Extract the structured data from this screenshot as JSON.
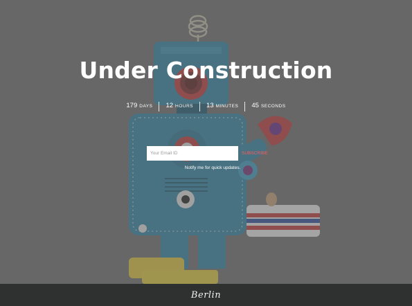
{
  "page": {
    "title": "Under Construction"
  },
  "countdown": [
    {
      "value": "179",
      "unit": "days"
    },
    {
      "value": "12",
      "unit": "hours"
    },
    {
      "value": "13",
      "unit": "minutes"
    },
    {
      "value": "45",
      "unit": "seconds"
    }
  ],
  "subscribe": {
    "placeholder": "Your Email ID",
    "button_label": "SUBSCRIBE",
    "note": "Notify me for quick updates."
  },
  "footer": {
    "brand": "Berlin"
  },
  "colors": {
    "overlay": "#5f5f5f",
    "footer_bg": "#2f3131",
    "accent": "#ff5a5a",
    "robot_body": "#2f86a6"
  },
  "background_image": {
    "subject": "toy-robot-illustration"
  }
}
